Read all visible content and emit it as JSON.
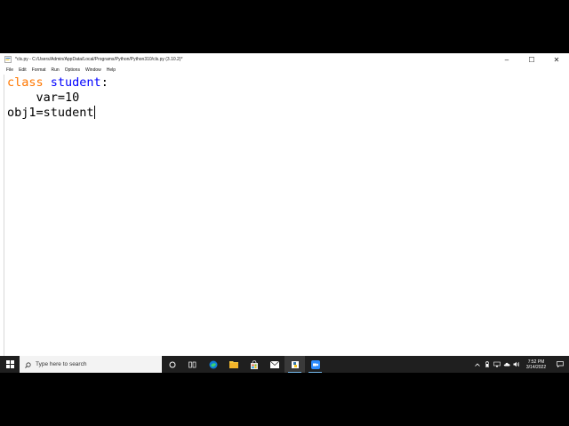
{
  "window": {
    "title": "*cls.py - C:/Users/Admin/AppData/Local/Programs/Python/Python310/cls.py (3.10.2)*",
    "minimize_glyph": "–",
    "maximize_glyph": "☐",
    "close_glyph": "✕"
  },
  "menu": {
    "items": [
      "File",
      "Edit",
      "Format",
      "Run",
      "Options",
      "Window",
      "Help"
    ]
  },
  "editor": {
    "line1": {
      "keyword": "class",
      "name": "student",
      "rest": ":"
    },
    "line2": "    var=10",
    "line3": "obj1=student"
  },
  "taskbar": {
    "search_placeholder": "Type here to search",
    "clock_time": "7:52 PM",
    "clock_date": "3/14/2022"
  },
  "colors": {
    "keyword": "#ff7700",
    "definition": "#0000ff",
    "taskbar_bg": "#1f1f1f",
    "running_indicator": "#76b9ed"
  },
  "icons": {
    "start": "windows-start-icon",
    "search": "search-icon",
    "cortana": "cortana-circle-icon",
    "task_view": "task-view-icon",
    "edge": "edge-browser-icon",
    "explorer": "file-explorer-icon",
    "store": "store-icon",
    "mail": "mail-icon",
    "idle": "idle-python-icon",
    "zoom": "video-meeting-icon"
  }
}
